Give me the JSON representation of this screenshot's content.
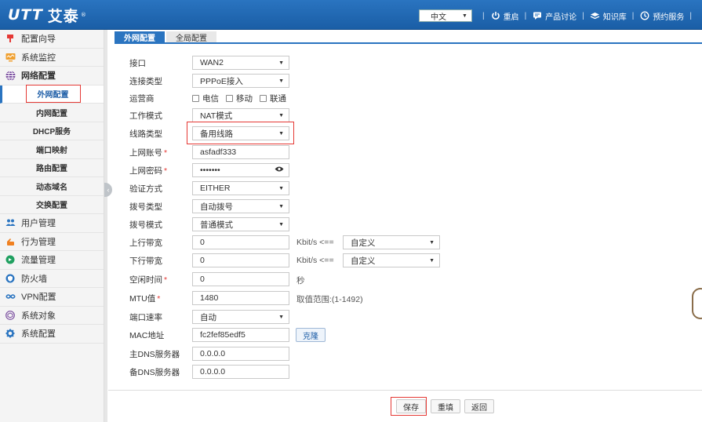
{
  "brand": {
    "logo_mark": "UTT",
    "name": "艾泰",
    "tm": "®"
  },
  "topbar": {
    "language": "中文",
    "links": [
      {
        "label": "重启",
        "icon": "power-icon"
      },
      {
        "label": "产品讨论",
        "icon": "chat-icon"
      },
      {
        "label": "知识库",
        "icon": "book-icon"
      },
      {
        "label": "预约服务",
        "icon": "clock-icon"
      }
    ]
  },
  "sidebar": {
    "items": [
      {
        "label": "配置向导",
        "icon": "pin-icon",
        "color": "#e53935"
      },
      {
        "label": "系统监控",
        "icon": "monitor-icon",
        "color": "#f0a030"
      },
      {
        "label": "网络配置",
        "icon": "globe-icon",
        "color": "#7b4fa0"
      }
    ],
    "subitems": [
      "外网配置",
      "内网配置",
      "DHCP服务",
      "端口映射",
      "路由配置",
      "动态域名",
      "交换配置"
    ],
    "items2": [
      {
        "label": "用户管理",
        "icon": "users-icon",
        "color": "#2a74c0"
      },
      {
        "label": "行为管理",
        "icon": "hand-icon",
        "color": "#f08020"
      },
      {
        "label": "流量管理",
        "icon": "traffic-icon",
        "color": "#20a060"
      },
      {
        "label": "防火墙",
        "icon": "shield-icon",
        "color": "#2a74c0"
      },
      {
        "label": "VPN配置",
        "icon": "vpn-icon",
        "color": "#2a74c0"
      },
      {
        "label": "系统对象",
        "icon": "cube-icon",
        "color": "#7b4fa0"
      },
      {
        "label": "系统配置",
        "icon": "gear-icon",
        "color": "#2a74c0"
      }
    ]
  },
  "tabs": [
    "外网配置",
    "全局配置"
  ],
  "form": {
    "interface": {
      "label": "接口",
      "value": "WAN2"
    },
    "conn_type": {
      "label": "连接类型",
      "value": "PPPoE接入"
    },
    "isp": {
      "label": "运营商",
      "options": [
        "电信",
        "移动",
        "联通"
      ]
    },
    "work_mode": {
      "label": "工作模式",
      "value": "NAT模式"
    },
    "line_type": {
      "label": "线路类型",
      "value": "备用线路"
    },
    "account": {
      "label": "上网账号",
      "value": "asfadf333"
    },
    "password": {
      "label": "上网密码",
      "value": "•••••••"
    },
    "auth": {
      "label": "验证方式",
      "value": "EITHER"
    },
    "dial_type": {
      "label": "拨号类型",
      "value": "自动拨号"
    },
    "dial_mode": {
      "label": "拨号模式",
      "value": "普通模式"
    },
    "up_bw": {
      "label": "上行带宽",
      "value": "0",
      "unit": "Kbit/s <==",
      "preset": "自定义"
    },
    "down_bw": {
      "label": "下行带宽",
      "value": "0",
      "unit": "Kbit/s <==",
      "preset": "自定义"
    },
    "idle": {
      "label": "空闲时间",
      "value": "0",
      "unit": "秒"
    },
    "mtu": {
      "label": "MTU值",
      "value": "1480",
      "hint": "取值范围:(1-1492)"
    },
    "port_speed": {
      "label": "端口速率",
      "value": "自动"
    },
    "mac": {
      "label": "MAC地址",
      "value": "fc2fef85edf5",
      "clone": "克隆"
    },
    "dns1": {
      "label": "主DNS服务器",
      "value": "0.0.0.0"
    },
    "dns2": {
      "label": "备DNS服务器",
      "value": "0.0.0.0"
    }
  },
  "buttons": {
    "save": "保存",
    "reset": "重填",
    "back": "返回"
  },
  "colors": {
    "primary": "#2a74c0",
    "highlight": "#e53935"
  }
}
